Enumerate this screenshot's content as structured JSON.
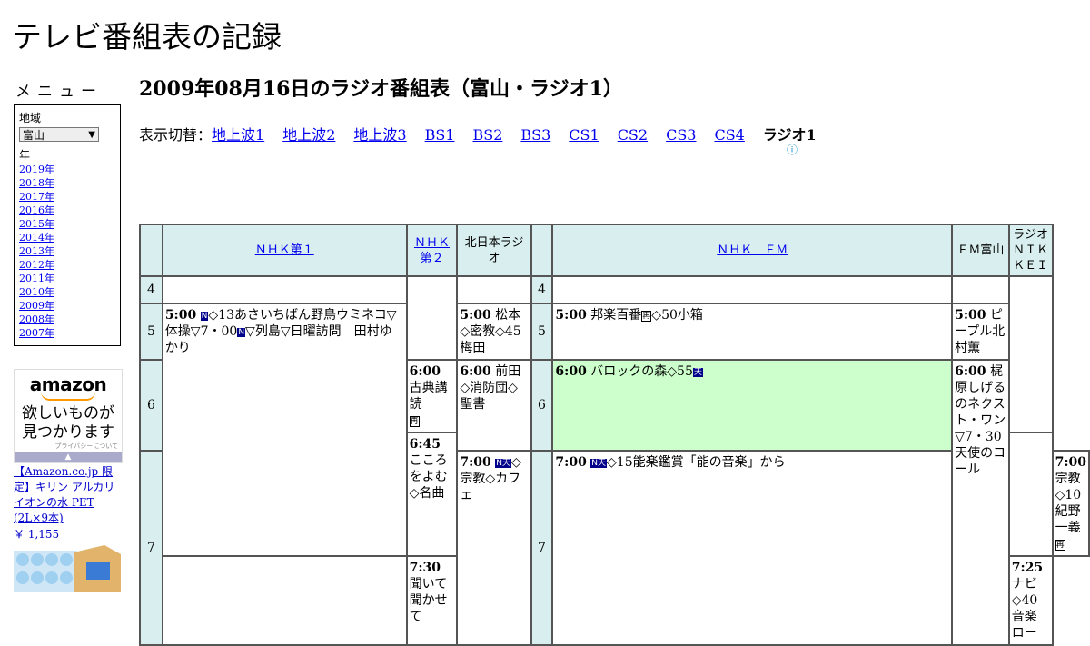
{
  "site_title": "テレビ番組表の記録",
  "sidebar": {
    "menu_title": "メニュー",
    "region_label": "地域",
    "region_value": "富山",
    "year_label": "年",
    "years": [
      "2019年",
      "2018年",
      "2017年",
      "2016年",
      "2015年",
      "2014年",
      "2013年",
      "2012年",
      "2011年",
      "2010年",
      "2009年",
      "2008年",
      "2007年"
    ]
  },
  "ad": {
    "logo": "amazon",
    "copy_line1": "欲しいものが",
    "copy_line2": "見つかります",
    "privacy": "プライバシーについて",
    "link_text": "【Amazon.co.jp 限定】キリン アルカリイオンの水 PET (2L×9本)",
    "price": "￥ 1,155"
  },
  "page_title": "2009年08月16日のラジオ番組表（富山・ラジオ1）",
  "switcher": {
    "label": "表示切替：",
    "links": [
      "地上波1",
      "地上波2",
      "地上波3",
      "BS1",
      "BS2",
      "BS3",
      "CS1",
      "CS2",
      "CS3",
      "CS4"
    ],
    "current": "ラジオ1"
  },
  "channels": {
    "nhk1": "ＮＨＫ第１",
    "nhk2": "ＮＨＫ第２",
    "kitanihon": "北日本ラジオ",
    "nhkfm": "ＮＨＫ　ＦＭ",
    "fmtoyama": "ＦＭ富山",
    "nikkei": "ラジオＮＩＫＫＥＩ"
  },
  "hours": [
    "4",
    "5",
    "6",
    "7"
  ],
  "programs": {
    "nhk1_500": {
      "time": "5:00",
      "badge": "N",
      "text_a": "◇13あさいちばん野鳥ウミネコ▽体操▽7・00",
      "badge2": "N",
      "text_b": "▽列島▽日曜訪問　田村ゆかり"
    },
    "nhk2_600": {
      "time": "6:00",
      "text": "古典講読",
      "badge": "再"
    },
    "nhk2_645": {
      "time": "6:45",
      "text": "こころをよむ◇名曲"
    },
    "nhk2_730": {
      "time": "7:30",
      "text": "聞いて聞かせて"
    },
    "kita_500": {
      "time": "5:00",
      "text": "松本◇密教◇45梅田"
    },
    "kita_600": {
      "time": "6:00",
      "text": "前田◇消防団◇聖書"
    },
    "kita_700": {
      "time": "7:00",
      "badge": "N天",
      "text": "◇宗教◇カフェ"
    },
    "fm_500": {
      "time": "5:00",
      "text": "邦楽百番",
      "badge": "再",
      "text_b": "◇50小箱"
    },
    "fm_600": {
      "time": "6:00",
      "text": "バロックの森◇55",
      "badge": "天"
    },
    "fm_700": {
      "time": "7:00",
      "badge": "N天",
      "text": "◇15能楽鑑賞「能の音楽」から"
    },
    "fmt_500": {
      "time": "5:00",
      "text": "ピープル北村薫"
    },
    "fmt_600": {
      "time": "6:00",
      "text": "梶原しげるのネクスト・ワン▽7・30天使のコール"
    },
    "nik_700": {
      "time": "7:00",
      "text": "宗教◇10紀野一義",
      "badge": "再"
    },
    "nik_725": {
      "time": "7:25",
      "text": "ナビ◇40音楽ロー"
    }
  },
  "colors": {
    "header_bg": "#d9eeee",
    "highlight": "#ccffcc",
    "link": "#0000ee",
    "badge": "#00008b"
  }
}
